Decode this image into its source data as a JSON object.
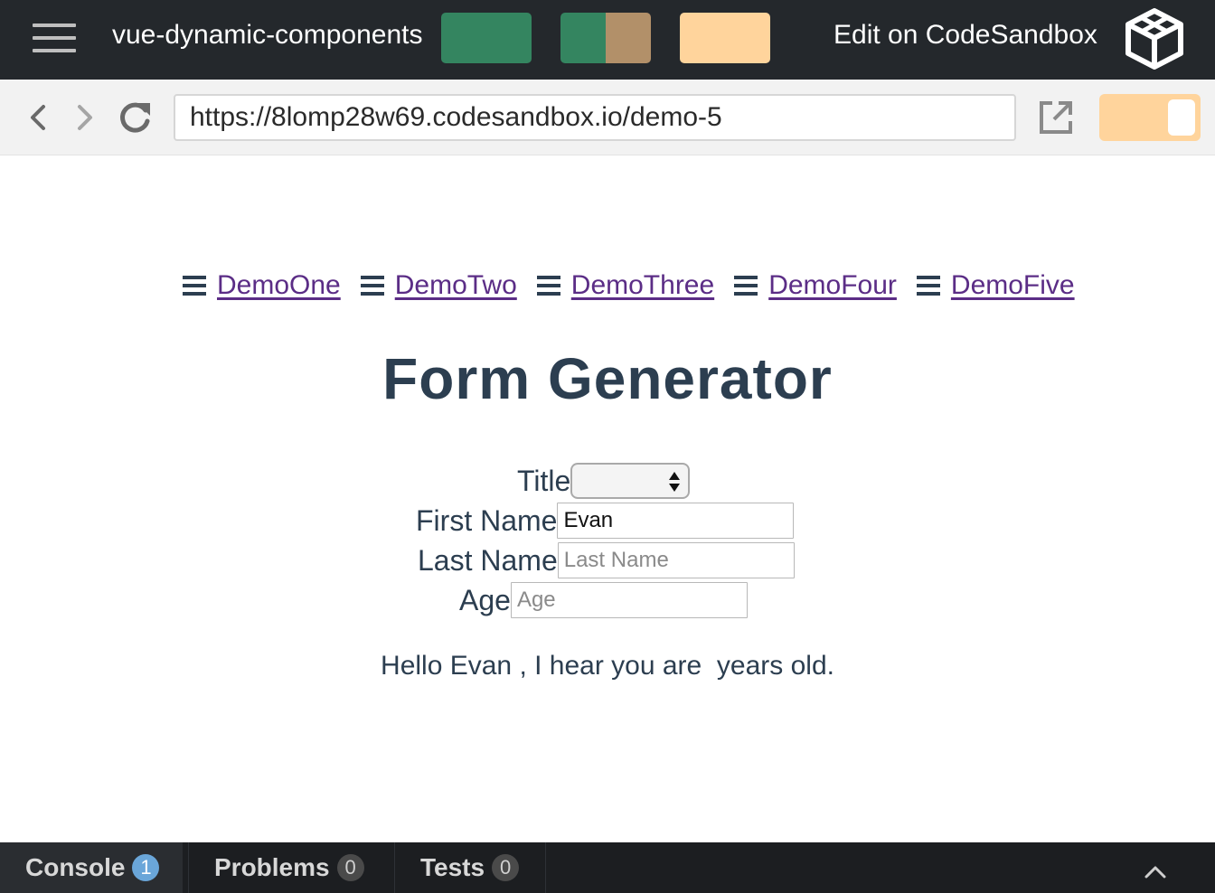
{
  "header": {
    "menu_icon": "hamburger-menu-icon",
    "title": "vue-dynamic-components",
    "swatches": [
      "#348560",
      [
        "#348560",
        "#b29069"
      ],
      "#ffd49c"
    ],
    "edit_label": "Edit on CodeSandbox",
    "logo_icon": "codesandbox-cube-icon"
  },
  "browser": {
    "back_icon": "chevron-left-icon",
    "forward_icon": "chevron-right-icon",
    "reload_icon": "reload-icon",
    "url": "https://8lomp28w69.codesandbox.io/demo-5",
    "open_icon": "open-in-new-window-icon",
    "toggle_color": "#ffd49c"
  },
  "nav": {
    "links": [
      "DemoOne",
      "DemoTwo",
      "DemoThree",
      "DemoFour",
      "DemoFive"
    ],
    "link_color": "#5b2d86"
  },
  "page": {
    "title": "Form Generator",
    "form": {
      "title_label": "Title",
      "title_value": "",
      "first_name_label": "First Name",
      "first_name_value": "Evan",
      "first_name_placeholder": "First Name",
      "last_name_label": "Last Name",
      "last_name_value": "",
      "last_name_placeholder": "Last Name",
      "age_label": "Age",
      "age_value": "",
      "age_placeholder": "Age"
    },
    "greeting": "Hello Evan , I hear you are  years old.",
    "text_color": "#2c3e50"
  },
  "console": {
    "tabs": [
      {
        "label": "Console",
        "count": "1"
      },
      {
        "label": "Problems",
        "count": "0"
      },
      {
        "label": "Tests",
        "count": "0"
      }
    ],
    "collapse_icon": "chevron-up-icon"
  }
}
